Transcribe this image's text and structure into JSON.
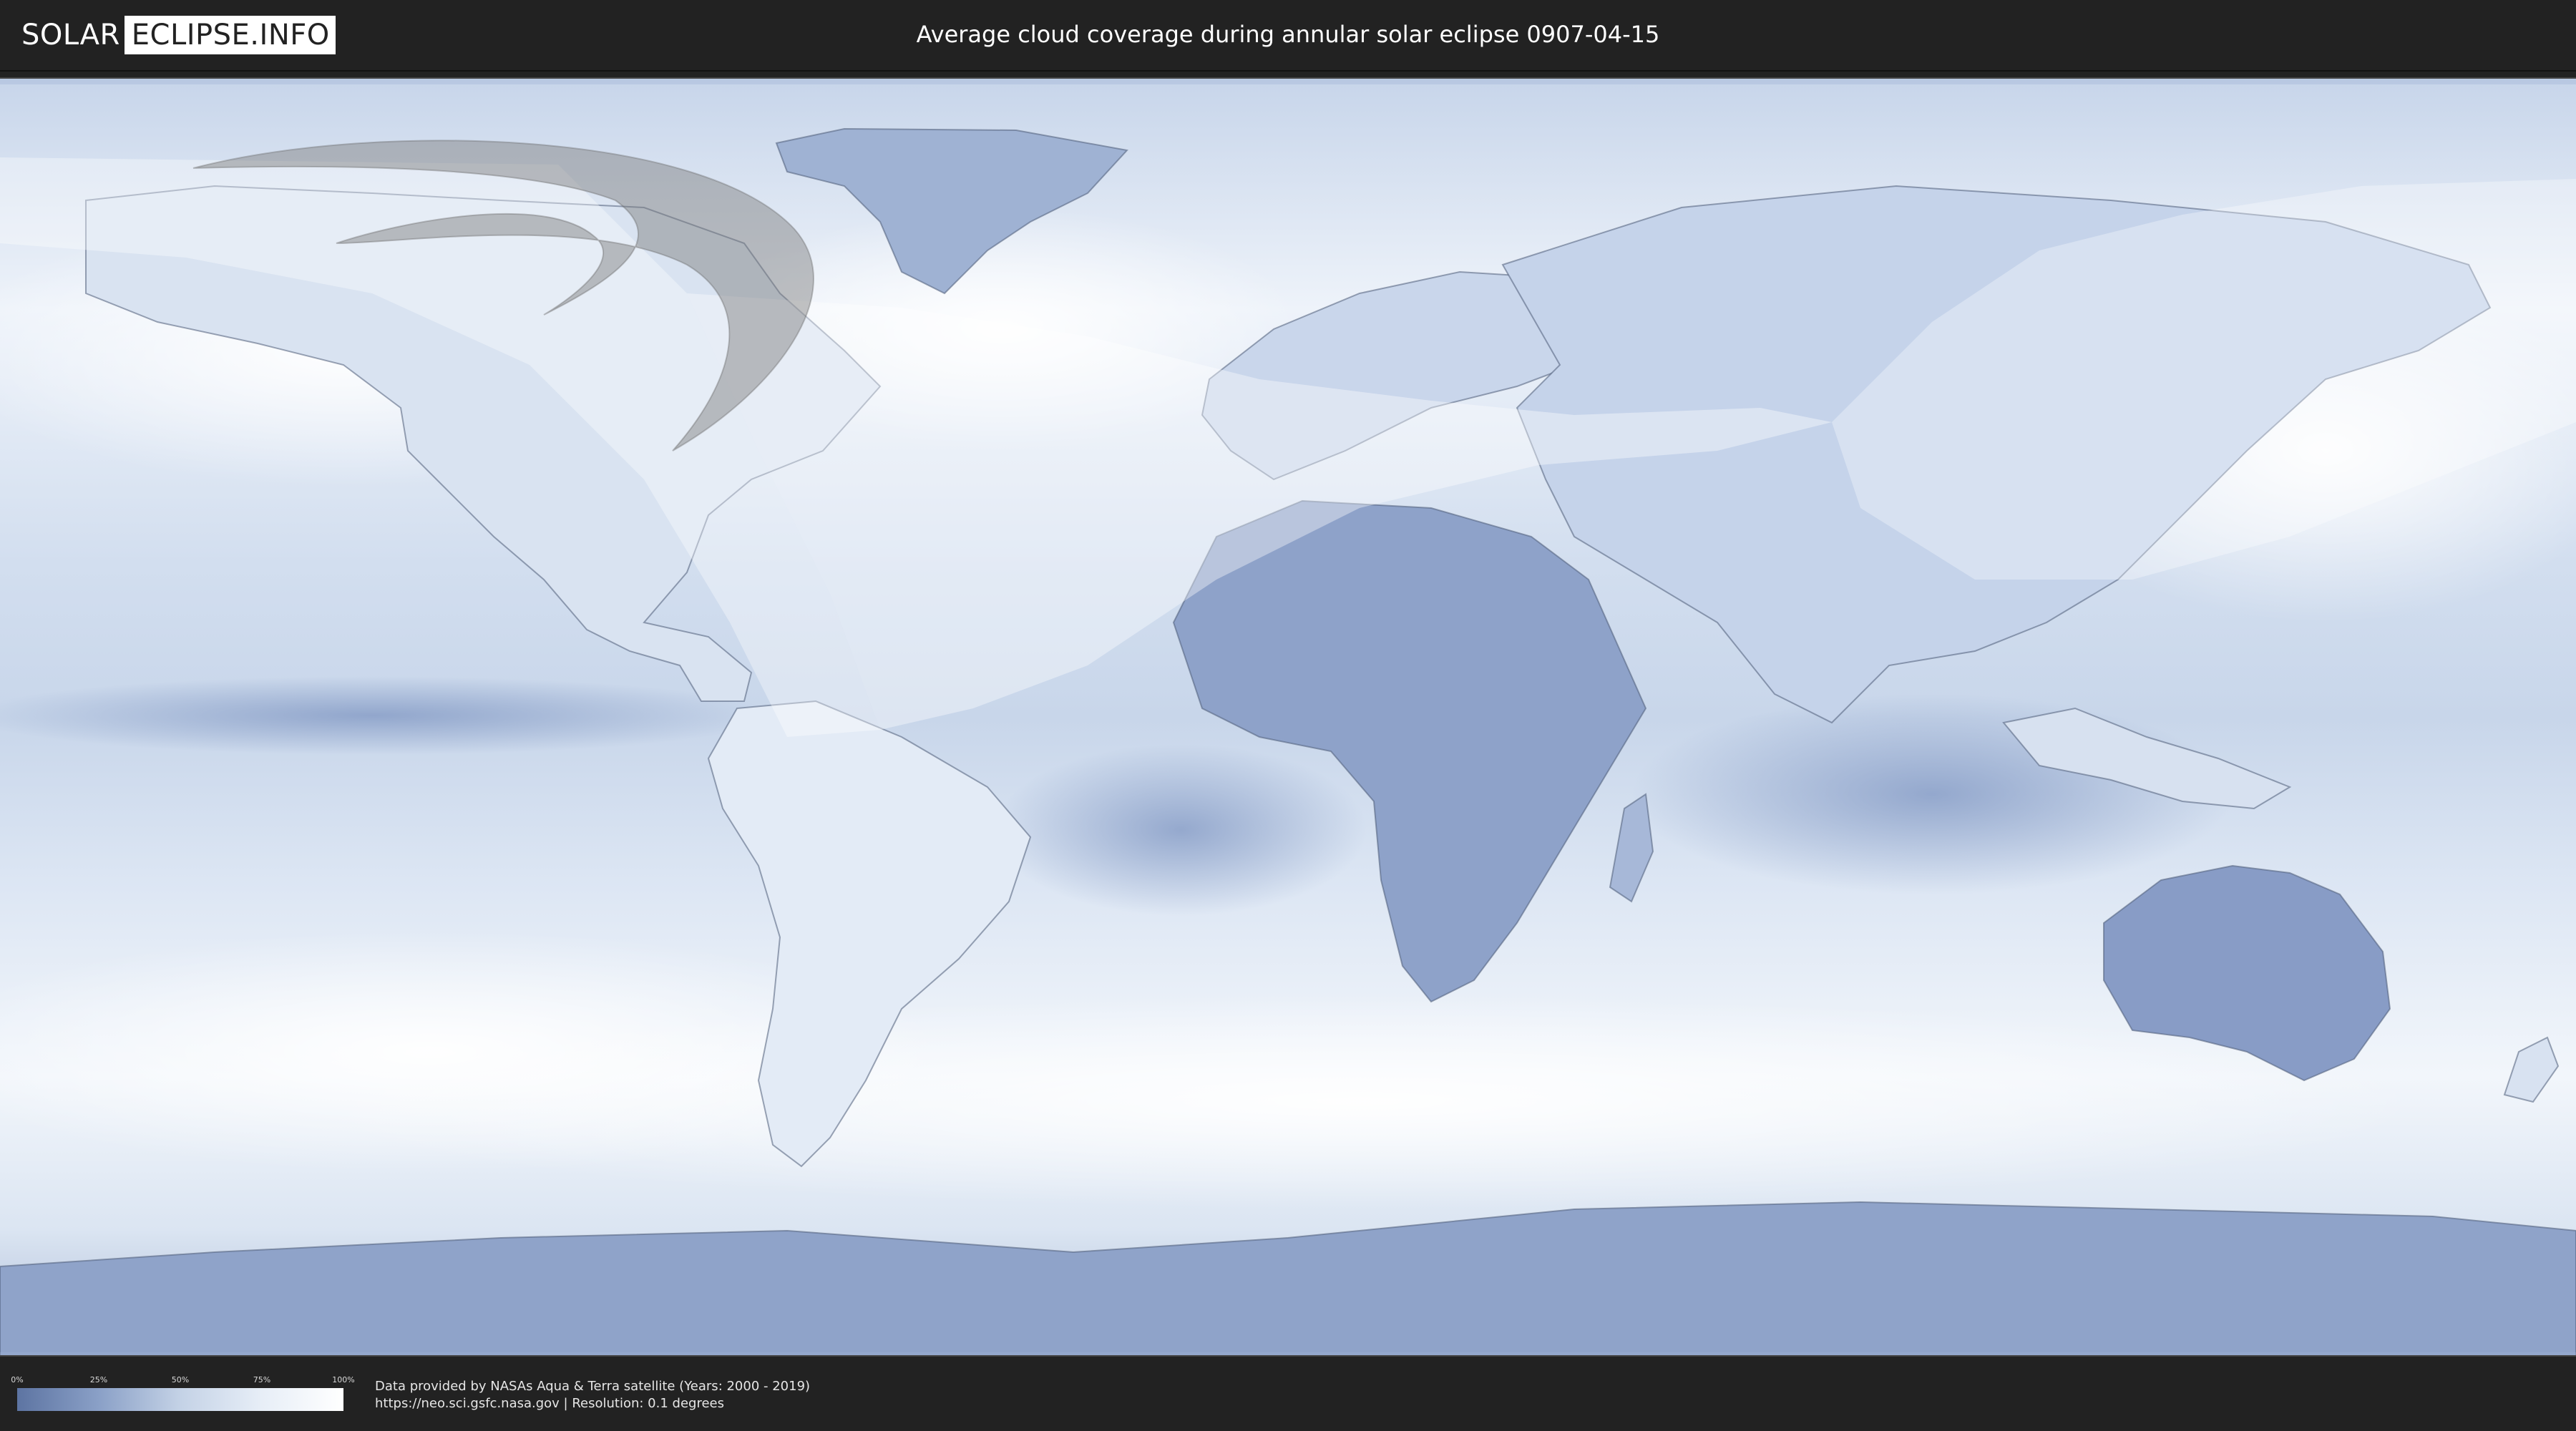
{
  "brand": {
    "left": "SOLAR",
    "right": "ECLIPSE.INFO"
  },
  "title": "Average cloud coverage during annular solar eclipse 0907-04-15",
  "legend": {
    "ticks": [
      "0%",
      "25%",
      "50%",
      "75%",
      "100%"
    ],
    "colors": [
      "#5d74a2",
      "#8aa0c7",
      "#c4d2e6",
      "#e7eef7",
      "#ffffff"
    ]
  },
  "credits": {
    "line1": "Data provided by NASAs Aqua & Terra satellite (Years: 2000 - 2019)",
    "line2": "https://neo.sci.gsfc.nasa.gov | Resolution: 0.1 degrees"
  },
  "map": {
    "ocean_color": "#e4ecf6",
    "land_outline_color": "#4f5d78",
    "eclipse_path_color": "#6f6f6f",
    "visibility_overlay_color": "#ffffff"
  }
}
